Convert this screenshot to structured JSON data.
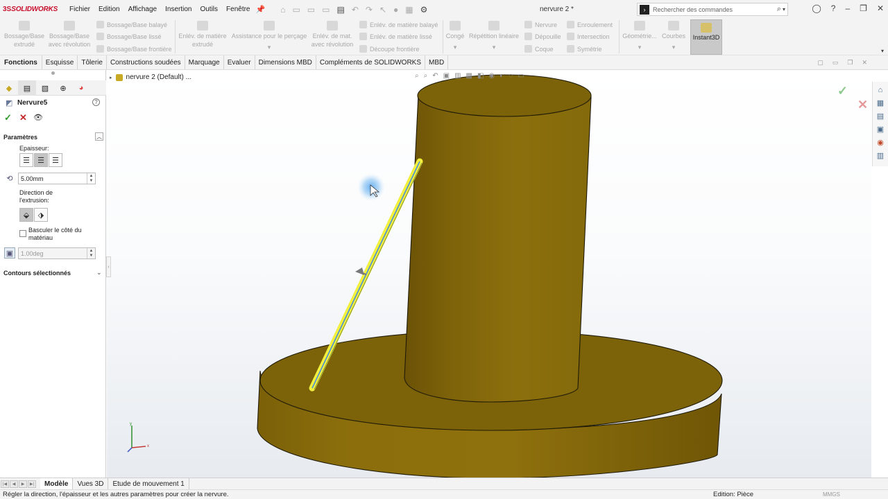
{
  "app": {
    "brand_ds": "3S",
    "brand_name": "SOLIDWORKS",
    "document_title": "nervure 2 *",
    "menu": [
      "Fichier",
      "Edition",
      "Affichage",
      "Insertion",
      "Outils",
      "Fenêtre"
    ],
    "search_placeholder": "Rechercher des commandes"
  },
  "command_manager": {
    "bossage_extrude": "Bossage/Base extrudé",
    "bossage_revolution": "Bossage/Base avec révolution",
    "bossage_balaye": "Bossage/Base balayé",
    "bossage_lisse": "Bossage/Base lissé",
    "bossage_frontiere": "Bossage/Base frontière",
    "enlev_extrude": "Enlév. de matière extrudé",
    "assistance_percage": "Assistance pour le perçage",
    "enlev_revolution": "Enlév. de mat. avec révolution",
    "enlev_balaye": "Enlév. de matière balayé",
    "enlev_lisse": "Enlév. de matière lissé",
    "decoupe_frontiere": "Découpe frontière",
    "conge": "Congé",
    "repetition_lineaire": "Répétition linéaire",
    "nervure": "Nervure",
    "depouille": "Dépouille",
    "coque": "Coque",
    "enroulement": "Enroulement",
    "intersection": "Intersection",
    "symetrie": "Symétrie",
    "geometrie": "Géométrie...",
    "courbes": "Courbes",
    "instant3d": "Instant3D"
  },
  "tabs": [
    "Fonctions",
    "Esquisse",
    "Tôlerie",
    "Constructions soudées",
    "Marquage",
    "Evaluer",
    "Dimensions MBD",
    "Compléments de SOLIDWORKS",
    "MBD"
  ],
  "property_manager": {
    "title": "Nervure5",
    "help": "?",
    "params_group": "Paramètres",
    "thickness_label": "Epaisseur:",
    "thickness_value": "5.00mm",
    "direction_label": "Direction de l'extrusion:",
    "flip_label": "Basculer le côté du matériau",
    "draft_value": "1.00deg",
    "contours_group": "Contours sélectionnés"
  },
  "viewport": {
    "tree_item": "nervure 2 (Default) ..."
  },
  "bottom_tabs": [
    "Modèle",
    "Vues 3D",
    "Etude de mouvement 1"
  ],
  "status": {
    "message": "Régler la direction, l'épaisseur et les autres paramètres pour créer la nervure.",
    "mode": "Edition: Pièce",
    "units": "MMGS"
  },
  "colors": {
    "part_body": "#8a6c0c",
    "part_top": "#7a6008",
    "sketch_highlight": "#f2f03c",
    "sketch_line": "#4a8fd8"
  }
}
